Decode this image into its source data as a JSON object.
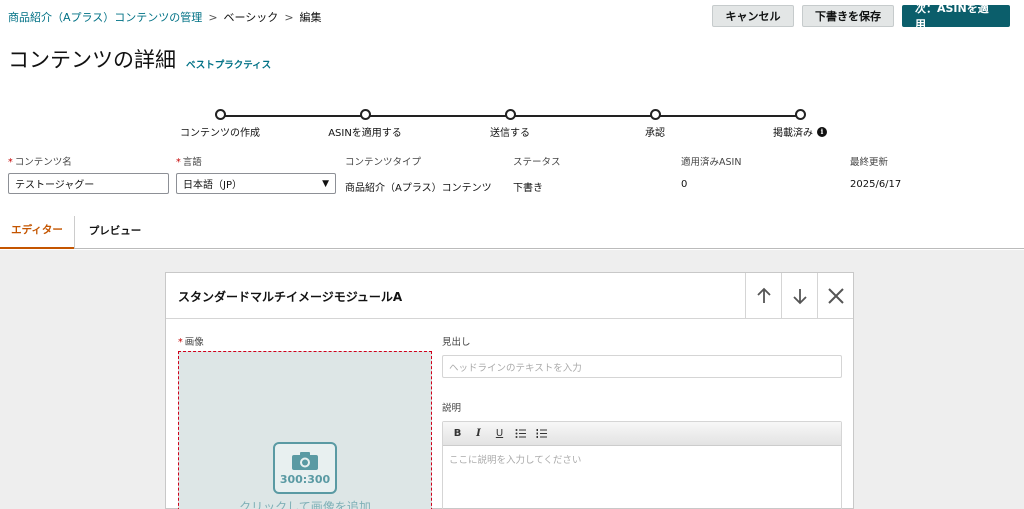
{
  "breadcrumb": {
    "items": [
      "商品紹介（Aプラス）コンテンツの管理",
      "ベーシック",
      "編集"
    ],
    "separator": ">"
  },
  "actions": {
    "cancel": "キャンセル",
    "save_draft": "下書きを保存",
    "next": "次：ASINを適用"
  },
  "header": {
    "title": "コンテンツの詳細",
    "best_practice": "ベストプラクティス"
  },
  "stepper": {
    "steps": [
      "コンテンツの作成",
      "ASINを適用する",
      "送信する",
      "承認",
      "掲載済み"
    ],
    "info_icon": "i"
  },
  "meta": {
    "required_mark": "*",
    "content_name_label": "コンテンツ名",
    "content_name_value": "テストージャグー",
    "language_label": "言語",
    "language_value": "日本語（JP）",
    "content_type_label": "コンテンツタイプ",
    "content_type_value": "商品紹介（Aプラス）コンテンツ",
    "status_label": "ステータス",
    "status_value": "下書き",
    "asin_label": "適用済みASIN",
    "asin_value": "0",
    "updated_label": "最終更新",
    "updated_value": "2025/6/17"
  },
  "tabs": {
    "editor": "エディター",
    "preview": "プレビュー"
  },
  "module": {
    "title": "スタンダードマルチイメージモジュールA",
    "image_label": "画像",
    "image_size": "300:300",
    "add_image": "クリックして画像を追加",
    "headline_label": "見出し",
    "headline_placeholder": "ヘッドラインのテキストを入力",
    "description_label": "説明",
    "description_placeholder": "ここに説明を入力してください",
    "toolbar": {
      "bold": "B",
      "italic": "I",
      "underline": "U"
    }
  },
  "colors": {
    "link": "#007185",
    "primary_button": "#0b5e6b",
    "active_tab": "#c45500",
    "required": "#c40000",
    "image_border": "#d0001a"
  }
}
